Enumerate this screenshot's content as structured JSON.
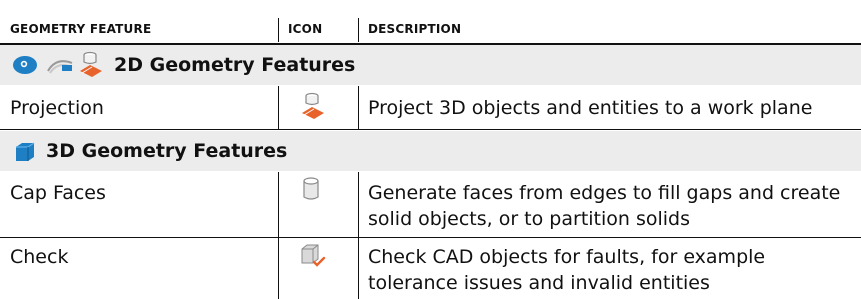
{
  "table": {
    "headers": {
      "feature": "GEOMETRY FEATURE",
      "icon": "ICON",
      "description": "DESCRIPTION"
    },
    "sections": [
      {
        "title": "2D Geometry Features",
        "icons": [
          "circle-blue-icon",
          "work-plane-icon",
          "projection-icon"
        ],
        "rows": [
          {
            "feature": "Projection",
            "icon": "projection-icon",
            "description": "Project 3D objects and entities to a work plane"
          }
        ]
      },
      {
        "title": "3D Geometry Features",
        "icons": [
          "cube-blue-icon"
        ],
        "rows": [
          {
            "feature": "Cap Faces",
            "icon": "cylinder-icon",
            "description": "Generate faces from edges to fill gaps and create solid objects, or to partition solids"
          },
          {
            "feature": "Check",
            "icon": "check-cube-icon",
            "description": "Check CAD objects for faults, for example tolerance issues and invalid entities"
          }
        ]
      }
    ]
  },
  "colors": {
    "section_bg": "#ececec",
    "accent_orange": "#e8632b",
    "accent_blue": "#1f7fc4"
  }
}
